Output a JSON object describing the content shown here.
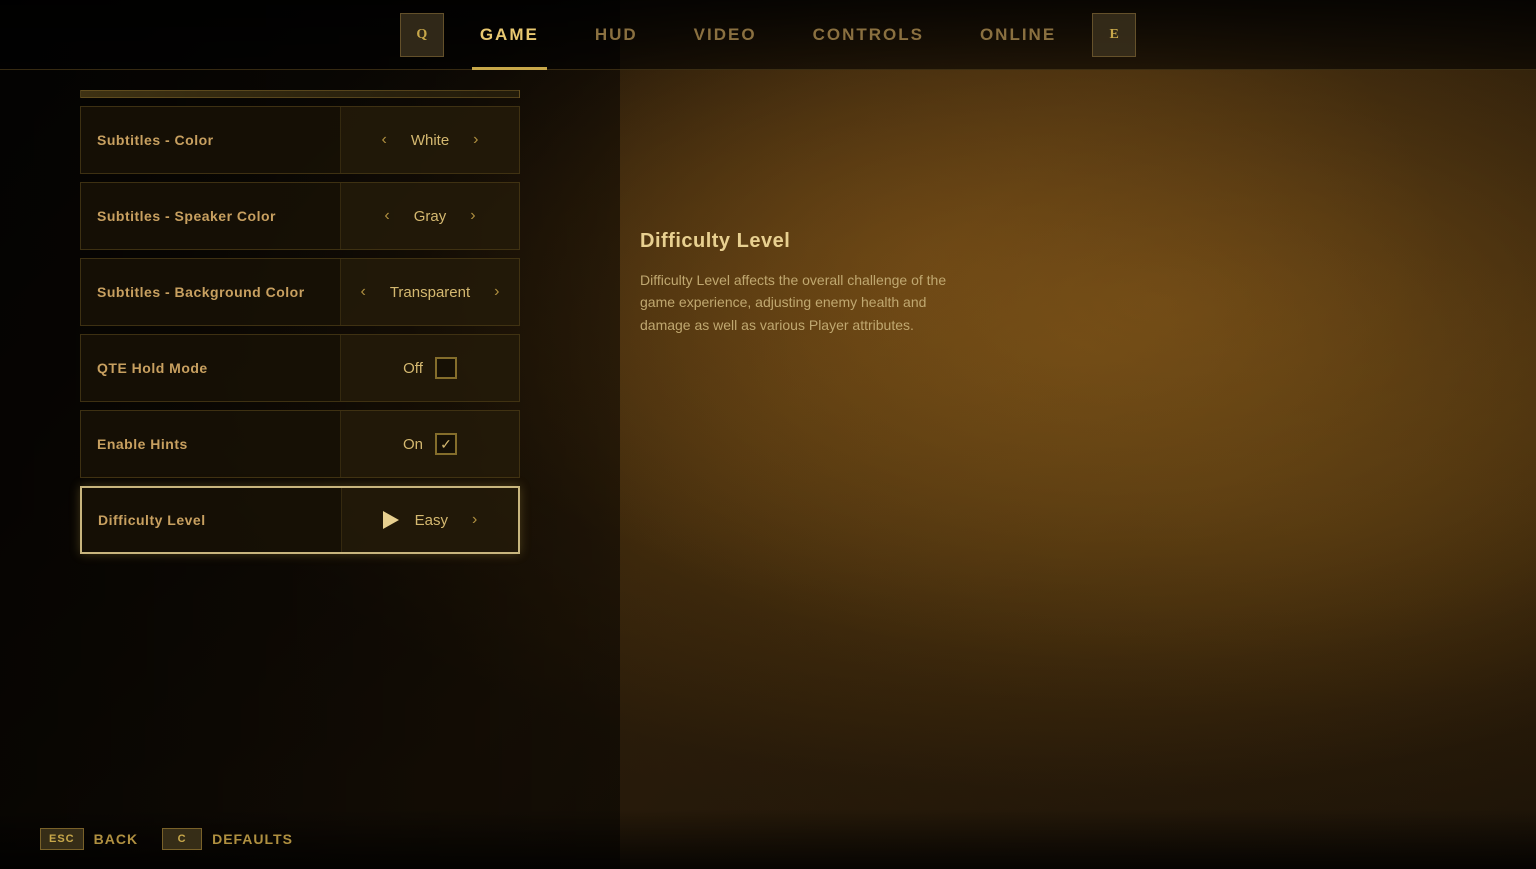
{
  "nav": {
    "tabs": [
      {
        "id": "game",
        "label": "GAME",
        "active": true
      },
      {
        "id": "hud",
        "label": "HUD",
        "active": false
      },
      {
        "id": "video",
        "label": "VIDEO",
        "active": false
      },
      {
        "id": "controls",
        "label": "CONTROLS",
        "active": false
      },
      {
        "id": "online",
        "label": "ONLINE",
        "active": false
      }
    ],
    "left_icon": "Q",
    "right_icon": "E"
  },
  "settings": [
    {
      "id": "subtitles-color",
      "label": "Subtitles - Color",
      "value": "White",
      "type": "select",
      "selected": false
    },
    {
      "id": "subtitles-speaker-color",
      "label": "Subtitles - Speaker Color",
      "value": "Gray",
      "type": "select",
      "selected": false
    },
    {
      "id": "subtitles-bg-color",
      "label": "Subtitles - Background Color",
      "value": "Transparent",
      "type": "select",
      "selected": false
    },
    {
      "id": "qte-hold-mode",
      "label": "QTE Hold Mode",
      "value": "Off",
      "checked": false,
      "type": "checkbox",
      "selected": false
    },
    {
      "id": "enable-hints",
      "label": "Enable Hints",
      "value": "On",
      "checked": true,
      "type": "checkbox",
      "selected": false
    },
    {
      "id": "difficulty-level",
      "label": "Difficulty Level",
      "value": "Easy",
      "type": "select",
      "selected": true
    }
  ],
  "info": {
    "title": "Difficulty Level",
    "description": "Difficulty Level affects the overall challenge of the game experience, adjusting enemy health and damage as well as various Player attributes."
  },
  "bottom": {
    "back_key": "ESC",
    "back_label": "Back",
    "defaults_key": "C",
    "defaults_label": "Defaults"
  }
}
